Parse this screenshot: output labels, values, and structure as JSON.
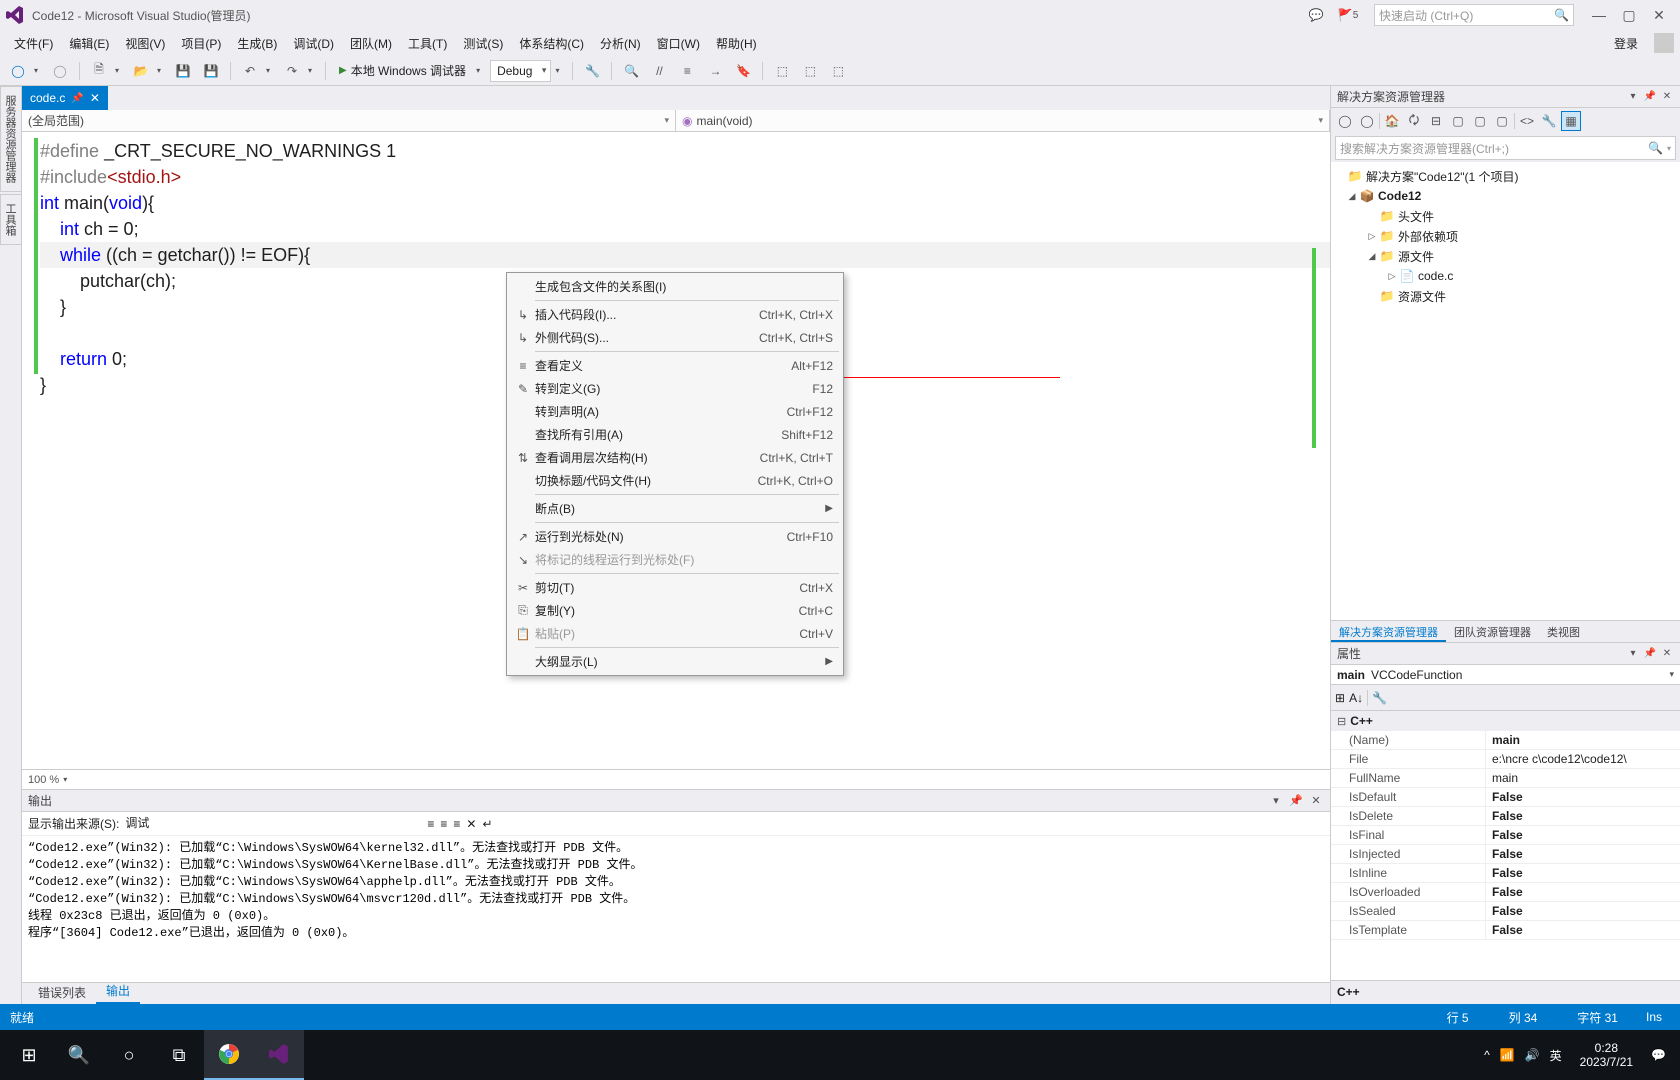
{
  "title": "Code12 - Microsoft Visual Studio(管理员)",
  "quicklaunch_ph": "快速启动 (Ctrl+Q)",
  "notif_count": "5",
  "menu": [
    "文件(F)",
    "编辑(E)",
    "视图(V)",
    "项目(P)",
    "生成(B)",
    "调试(D)",
    "团队(M)",
    "工具(T)",
    "测试(S)",
    "体系结构(C)",
    "分析(N)",
    "窗口(W)",
    "帮助(H)"
  ],
  "login": "登录",
  "toolbar": {
    "start": "本地 Windows 调试器",
    "config": "Debug"
  },
  "doc_tab": "code.c",
  "nav_left": "(全局范围)",
  "nav_right": "main(void)",
  "zoom": "100 %",
  "code_lines": [
    {
      "pp": "#define ",
      "txt": "_CRT_SECURE_NO_WARNINGS 1"
    },
    {
      "pp": "#include",
      "str": "<stdio.h>"
    },
    {
      "raw": "int main(void){",
      "kw1": "int",
      "mid": " main(",
      "kw2": "void",
      "end": "){"
    },
    {
      "raw": "    int ch = 0;",
      "ind": "    ",
      "kw": "int",
      "rest": " ch = 0;"
    },
    {
      "hl": true,
      "raw": "    while ((ch = getchar()) != EOF){",
      "ind": "    ",
      "kw": "while",
      "rest": " ((ch = getchar()) != ",
      "id": "EOF",
      "tail": "){"
    },
    {
      "plain": "        putchar(ch);"
    },
    {
      "plain": "    }"
    },
    {
      "plain": ""
    },
    {
      "raw": "    return 0;",
      "ind": "    ",
      "kw": "return",
      "rest": " 0;"
    },
    {
      "plain": "}"
    }
  ],
  "context_menu": [
    {
      "label": "生成包含文件的关系图(I)"
    },
    {
      "sep": true
    },
    {
      "ico": "↳",
      "label": "插入代码段(I)...",
      "sc": "Ctrl+K, Ctrl+X"
    },
    {
      "ico": "↳",
      "label": "外侧代码(S)...",
      "sc": "Ctrl+K, Ctrl+S"
    },
    {
      "sep": true
    },
    {
      "ico": "≡",
      "label": "查看定义",
      "sc": "Alt+F12"
    },
    {
      "ico": "✎",
      "label": "转到定义(G)",
      "sc": "F12"
    },
    {
      "label": "转到声明(A)",
      "sc": "Ctrl+F12"
    },
    {
      "label": "查找所有引用(A)",
      "sc": "Shift+F12"
    },
    {
      "ico": "⇅",
      "label": "查看调用层次结构(H)",
      "sc": "Ctrl+K, Ctrl+T"
    },
    {
      "label": "切换标题/代码文件(H)",
      "sc": "Ctrl+K, Ctrl+O"
    },
    {
      "sep": true
    },
    {
      "label": "断点(B)",
      "sub": true
    },
    {
      "sep": true
    },
    {
      "ico": "↗",
      "label": "运行到光标处(N)",
      "sc": "Ctrl+F10"
    },
    {
      "ico": "↘",
      "label": "将标记的线程运行到光标处(F)",
      "disabled": true
    },
    {
      "sep": true
    },
    {
      "ico": "✂",
      "label": "剪切(T)",
      "sc": "Ctrl+X"
    },
    {
      "ico": "⎘",
      "label": "复制(Y)",
      "sc": "Ctrl+C"
    },
    {
      "ico": "📋",
      "label": "粘贴(P)",
      "sc": "Ctrl+V",
      "disabled": true
    },
    {
      "sep": true
    },
    {
      "label": "大纲显示(L)",
      "sub": true
    }
  ],
  "output": {
    "title": "输出",
    "src_label": "显示输出来源(S):",
    "src_value": "调试",
    "lines": [
      "“Code12.exe”(Win32): 已加载“C:\\Windows\\SysWOW64\\kernel32.dll”。无法查找或打开 PDB 文件。",
      "“Code12.exe”(Win32): 已加载“C:\\Windows\\SysWOW64\\KernelBase.dll”。无法查找或打开 PDB 文件。",
      "“Code12.exe”(Win32): 已加载“C:\\Windows\\SysWOW64\\apphelp.dll”。无法查找或打开 PDB 文件。",
      "“Code12.exe”(Win32): 已加载“C:\\Windows\\SysWOW64\\msvcr120d.dll”。无法查找或打开 PDB 文件。",
      "线程 0x23c8 已退出，返回值为 0 (0x0)。",
      "程序“[3604] Code12.exe”已退出，返回值为 0 (0x0)。"
    ]
  },
  "bottom_tabs": {
    "errors": "错误列表",
    "output": "输出"
  },
  "solution": {
    "title": "解决方案资源管理器",
    "search_ph": "搜索解决方案资源管理器(Ctrl+;)",
    "root": "解决方案\"Code12\"(1 个项目)",
    "project": "Code12",
    "headers": "头文件",
    "external": "外部依赖项",
    "source": "源文件",
    "file": "code.c",
    "resource": "资源文件",
    "tabs": [
      "解决方案资源管理器",
      "团队资源管理器",
      "类视图"
    ]
  },
  "props": {
    "title": "属性",
    "obj_name": "main",
    "obj_type": "VCCodeFunction",
    "cat": "C++",
    "rows": [
      {
        "k": "(Name)",
        "v": "main",
        "bold": true
      },
      {
        "k": "File",
        "v": "e:\\ncre c\\code12\\code12\\"
      },
      {
        "k": "FullName",
        "v": "main"
      },
      {
        "k": "IsDefault",
        "v": "False",
        "bold": true
      },
      {
        "k": "IsDelete",
        "v": "False",
        "bold": true
      },
      {
        "k": "IsFinal",
        "v": "False",
        "bold": true
      },
      {
        "k": "IsInjected",
        "v": "False",
        "bold": true
      },
      {
        "k": "IsInline",
        "v": "False",
        "bold": true
      },
      {
        "k": "IsOverloaded",
        "v": "False",
        "bold": true
      },
      {
        "k": "IsSealed",
        "v": "False",
        "bold": true
      },
      {
        "k": "IsTemplate",
        "v": "False",
        "bold": true
      }
    ],
    "desc": "C++"
  },
  "status": {
    "ready": "就绪",
    "line": "行 5",
    "col": "列 34",
    "char": "字符 31",
    "ins": "Ins"
  },
  "tray": {
    "ime": "英",
    "time": "0:28",
    "date": "2023/7/21"
  }
}
